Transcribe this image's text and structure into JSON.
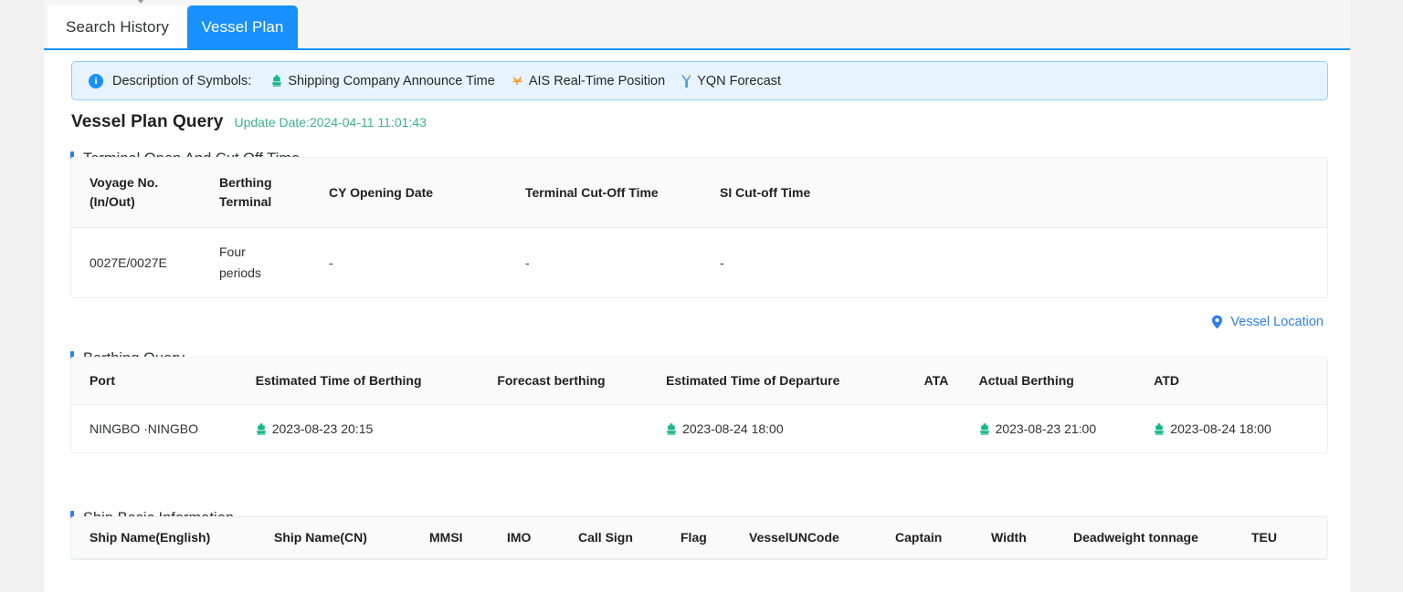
{
  "tabs": [
    {
      "label": "Search History",
      "active": false
    },
    {
      "label": "Vessel Plan",
      "active": true
    }
  ],
  "legend": {
    "label": "Description of Symbols:",
    "items": [
      {
        "icon": "ship-icon",
        "label": "Shipping Company Announce Time",
        "color": "#12b886"
      },
      {
        "icon": "ais-cross-icon",
        "label": "AIS Real-Time Position",
        "color": "#f2a33c"
      },
      {
        "icon": "forecast-y-icon",
        "label": "YQN Forecast",
        "color": "#4a9ae8"
      }
    ]
  },
  "header": {
    "title": "Vessel Plan Query",
    "update_date": "Update Date:2024-04-11 11:01:43",
    "update_date_color": "#3cb389"
  },
  "sections": {
    "terminal": {
      "title": "Terminal Open And Cut Off Time",
      "columns": [
        "Voyage No.\n(In/Out)",
        "Berthing\nTerminal",
        "CY Opening Date",
        "Terminal Cut-Off Time",
        "SI Cut-off Time"
      ],
      "rows": [
        {
          "voyage_no": "0027E/0027E",
          "berthing_terminal": "Four periods",
          "cy_opening_date": "-",
          "terminal_cut_off_time": "-",
          "si_cut_off_time": "-"
        }
      ]
    },
    "berthing": {
      "title": "Berthing Query",
      "vessel_location_label": "Vessel Location",
      "columns": [
        "Port",
        "Estimated Time of Berthing",
        "Forecast berthing",
        "Estimated Time of Departure",
        "ATA",
        "Actual Berthing",
        "ATD"
      ],
      "rows": [
        {
          "port": "NINGBO ·NINGBO",
          "etb": "2023-08-23 20:15",
          "etb_icon": "ship-icon",
          "forecast_berthing": "",
          "etd": "2023-08-24 18:00",
          "etd_icon": "ship-icon",
          "ata": "",
          "actual_berthing": "2023-08-23 21:00",
          "actual_berthing_icon": "ship-icon",
          "atd": "2023-08-24 18:00",
          "atd_icon": "ship-icon"
        }
      ]
    },
    "ship_info": {
      "title": "Ship Basic Information",
      "columns": [
        "Ship Name(English)",
        "Ship Name(CN)",
        "MMSI",
        "IMO",
        "Call Sign",
        "Flag",
        "VesselUNCode",
        "Captain",
        "Width",
        "Deadweight tonnage",
        "TEU"
      ]
    }
  },
  "colors": {
    "accent_blue": "#1890ff",
    "section_bar": "#2f80ed",
    "ship_green": "#12b886",
    "legend_bg": "#e8f4fd",
    "legend_border": "#91caff"
  }
}
